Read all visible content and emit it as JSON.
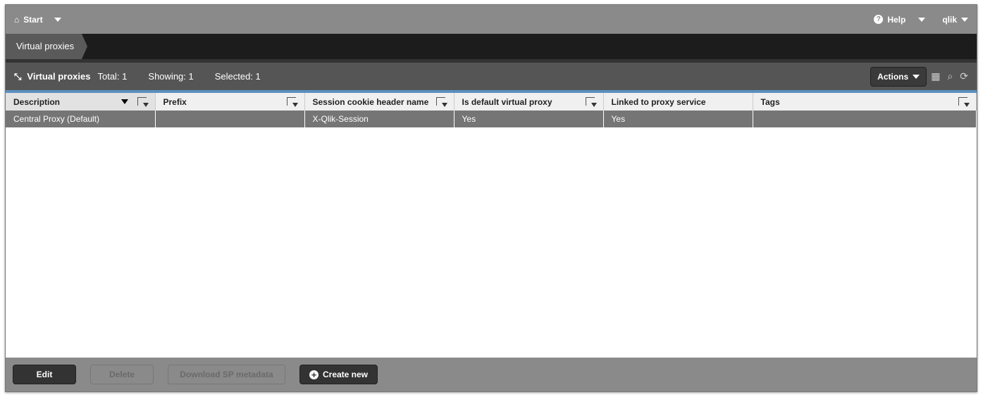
{
  "topbar": {
    "start": "Start",
    "help": "Help",
    "user": "qlik"
  },
  "breadcrumb": {
    "current": "Virtual proxies"
  },
  "toolbar": {
    "title": "Virtual proxies",
    "total": "Total: 1",
    "showing": "Showing: 1",
    "selected": "Selected: 1",
    "actions": "Actions"
  },
  "table": {
    "columns": [
      "Description",
      "Prefix",
      "Session cookie header name",
      "Is default virtual proxy",
      "Linked to proxy service",
      "Tags"
    ],
    "rows": [
      [
        "Central Proxy (Default)",
        "",
        "X-Qlik-Session",
        "Yes",
        "Yes",
        ""
      ]
    ]
  },
  "footer": {
    "edit": "Edit",
    "delete": "Delete",
    "download": "Download SP metadata",
    "create": "Create new"
  }
}
